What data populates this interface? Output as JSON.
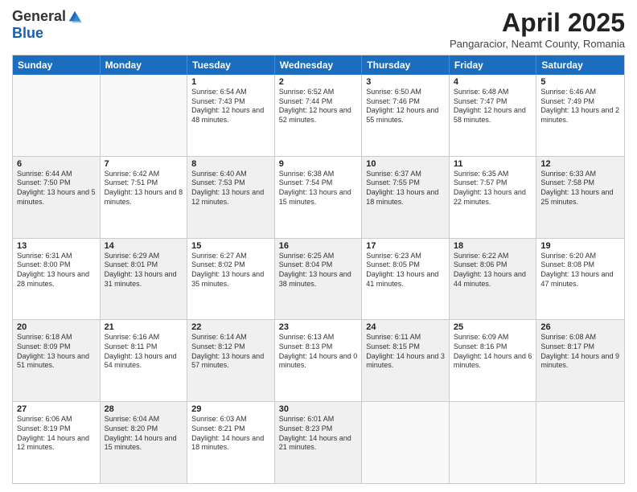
{
  "logo": {
    "general": "General",
    "blue": "Blue"
  },
  "title": "April 2025",
  "subtitle": "Pangaracior, Neamt County, Romania",
  "days": [
    "Sunday",
    "Monday",
    "Tuesday",
    "Wednesday",
    "Thursday",
    "Friday",
    "Saturday"
  ],
  "weeks": [
    [
      {
        "day": "",
        "empty": true
      },
      {
        "day": "",
        "empty": true
      },
      {
        "day": "1",
        "sunrise": "Sunrise: 6:54 AM",
        "sunset": "Sunset: 7:43 PM",
        "daylight": "Daylight: 12 hours and 48 minutes."
      },
      {
        "day": "2",
        "sunrise": "Sunrise: 6:52 AM",
        "sunset": "Sunset: 7:44 PM",
        "daylight": "Daylight: 12 hours and 52 minutes."
      },
      {
        "day": "3",
        "sunrise": "Sunrise: 6:50 AM",
        "sunset": "Sunset: 7:46 PM",
        "daylight": "Daylight: 12 hours and 55 minutes."
      },
      {
        "day": "4",
        "sunrise": "Sunrise: 6:48 AM",
        "sunset": "Sunset: 7:47 PM",
        "daylight": "Daylight: 12 hours and 58 minutes."
      },
      {
        "day": "5",
        "sunrise": "Sunrise: 6:46 AM",
        "sunset": "Sunset: 7:49 PM",
        "daylight": "Daylight: 13 hours and 2 minutes."
      }
    ],
    [
      {
        "day": "6",
        "sunrise": "Sunrise: 6:44 AM",
        "sunset": "Sunset: 7:50 PM",
        "daylight": "Daylight: 13 hours and 5 minutes.",
        "shaded": true
      },
      {
        "day": "7",
        "sunrise": "Sunrise: 6:42 AM",
        "sunset": "Sunset: 7:51 PM",
        "daylight": "Daylight: 13 hours and 8 minutes."
      },
      {
        "day": "8",
        "sunrise": "Sunrise: 6:40 AM",
        "sunset": "Sunset: 7:53 PM",
        "daylight": "Daylight: 13 hours and 12 minutes.",
        "shaded": true
      },
      {
        "day": "9",
        "sunrise": "Sunrise: 6:38 AM",
        "sunset": "Sunset: 7:54 PM",
        "daylight": "Daylight: 13 hours and 15 minutes."
      },
      {
        "day": "10",
        "sunrise": "Sunrise: 6:37 AM",
        "sunset": "Sunset: 7:55 PM",
        "daylight": "Daylight: 13 hours and 18 minutes.",
        "shaded": true
      },
      {
        "day": "11",
        "sunrise": "Sunrise: 6:35 AM",
        "sunset": "Sunset: 7:57 PM",
        "daylight": "Daylight: 13 hours and 22 minutes."
      },
      {
        "day": "12",
        "sunrise": "Sunrise: 6:33 AM",
        "sunset": "Sunset: 7:58 PM",
        "daylight": "Daylight: 13 hours and 25 minutes.",
        "shaded": true
      }
    ],
    [
      {
        "day": "13",
        "sunrise": "Sunrise: 6:31 AM",
        "sunset": "Sunset: 8:00 PM",
        "daylight": "Daylight: 13 hours and 28 minutes."
      },
      {
        "day": "14",
        "sunrise": "Sunrise: 6:29 AM",
        "sunset": "Sunset: 8:01 PM",
        "daylight": "Daylight: 13 hours and 31 minutes.",
        "shaded": true
      },
      {
        "day": "15",
        "sunrise": "Sunrise: 6:27 AM",
        "sunset": "Sunset: 8:02 PM",
        "daylight": "Daylight: 13 hours and 35 minutes."
      },
      {
        "day": "16",
        "sunrise": "Sunrise: 6:25 AM",
        "sunset": "Sunset: 8:04 PM",
        "daylight": "Daylight: 13 hours and 38 minutes.",
        "shaded": true
      },
      {
        "day": "17",
        "sunrise": "Sunrise: 6:23 AM",
        "sunset": "Sunset: 8:05 PM",
        "daylight": "Daylight: 13 hours and 41 minutes."
      },
      {
        "day": "18",
        "sunrise": "Sunrise: 6:22 AM",
        "sunset": "Sunset: 8:06 PM",
        "daylight": "Daylight: 13 hours and 44 minutes.",
        "shaded": true
      },
      {
        "day": "19",
        "sunrise": "Sunrise: 6:20 AM",
        "sunset": "Sunset: 8:08 PM",
        "daylight": "Daylight: 13 hours and 47 minutes."
      }
    ],
    [
      {
        "day": "20",
        "sunrise": "Sunrise: 6:18 AM",
        "sunset": "Sunset: 8:09 PM",
        "daylight": "Daylight: 13 hours and 51 minutes.",
        "shaded": true
      },
      {
        "day": "21",
        "sunrise": "Sunrise: 6:16 AM",
        "sunset": "Sunset: 8:11 PM",
        "daylight": "Daylight: 13 hours and 54 minutes."
      },
      {
        "day": "22",
        "sunrise": "Sunrise: 6:14 AM",
        "sunset": "Sunset: 8:12 PM",
        "daylight": "Daylight: 13 hours and 57 minutes.",
        "shaded": true
      },
      {
        "day": "23",
        "sunrise": "Sunrise: 6:13 AM",
        "sunset": "Sunset: 8:13 PM",
        "daylight": "Daylight: 14 hours and 0 minutes."
      },
      {
        "day": "24",
        "sunrise": "Sunrise: 6:11 AM",
        "sunset": "Sunset: 8:15 PM",
        "daylight": "Daylight: 14 hours and 3 minutes.",
        "shaded": true
      },
      {
        "day": "25",
        "sunrise": "Sunrise: 6:09 AM",
        "sunset": "Sunset: 8:16 PM",
        "daylight": "Daylight: 14 hours and 6 minutes."
      },
      {
        "day": "26",
        "sunrise": "Sunrise: 6:08 AM",
        "sunset": "Sunset: 8:17 PM",
        "daylight": "Daylight: 14 hours and 9 minutes.",
        "shaded": true
      }
    ],
    [
      {
        "day": "27",
        "sunrise": "Sunrise: 6:06 AM",
        "sunset": "Sunset: 8:19 PM",
        "daylight": "Daylight: 14 hours and 12 minutes."
      },
      {
        "day": "28",
        "sunrise": "Sunrise: 6:04 AM",
        "sunset": "Sunset: 8:20 PM",
        "daylight": "Daylight: 14 hours and 15 minutes.",
        "shaded": true
      },
      {
        "day": "29",
        "sunrise": "Sunrise: 6:03 AM",
        "sunset": "Sunset: 8:21 PM",
        "daylight": "Daylight: 14 hours and 18 minutes."
      },
      {
        "day": "30",
        "sunrise": "Sunrise: 6:01 AM",
        "sunset": "Sunset: 8:23 PM",
        "daylight": "Daylight: 14 hours and 21 minutes.",
        "shaded": true
      },
      {
        "day": "",
        "empty": true
      },
      {
        "day": "",
        "empty": true
      },
      {
        "day": "",
        "empty": true
      }
    ]
  ]
}
